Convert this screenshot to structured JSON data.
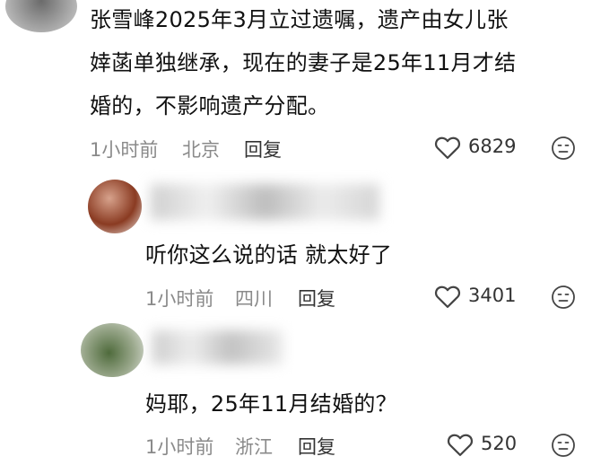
{
  "comments": [
    {
      "text_lines": [
        "张雪峰2025年3月立过遗嘱，遗产由女儿张",
        "婞菡单独继承，现在的妻子是25年11月才结",
        "婚的，不影响遗产分配。"
      ],
      "time": "1小时前",
      "location": "北京",
      "reply_label": "回复",
      "likes": "6829"
    },
    {
      "text_lines": [
        "听你这么说的话 就太好了"
      ],
      "time": "1小时前",
      "location": "四川",
      "reply_label": "回复",
      "likes": "3401"
    },
    {
      "text_lines": [
        "妈耶，25年11月结婚的？"
      ],
      "time": "1小时前",
      "location": "浙江",
      "reply_label": "回复",
      "likes": "520"
    }
  ],
  "icons": {
    "like": "heart-outline-icon",
    "reaction": "emoji-face-icon"
  },
  "colors": {
    "text": "#111111",
    "meta": "#8a8a8a",
    "action": "#333333",
    "icon": "#444444"
  }
}
